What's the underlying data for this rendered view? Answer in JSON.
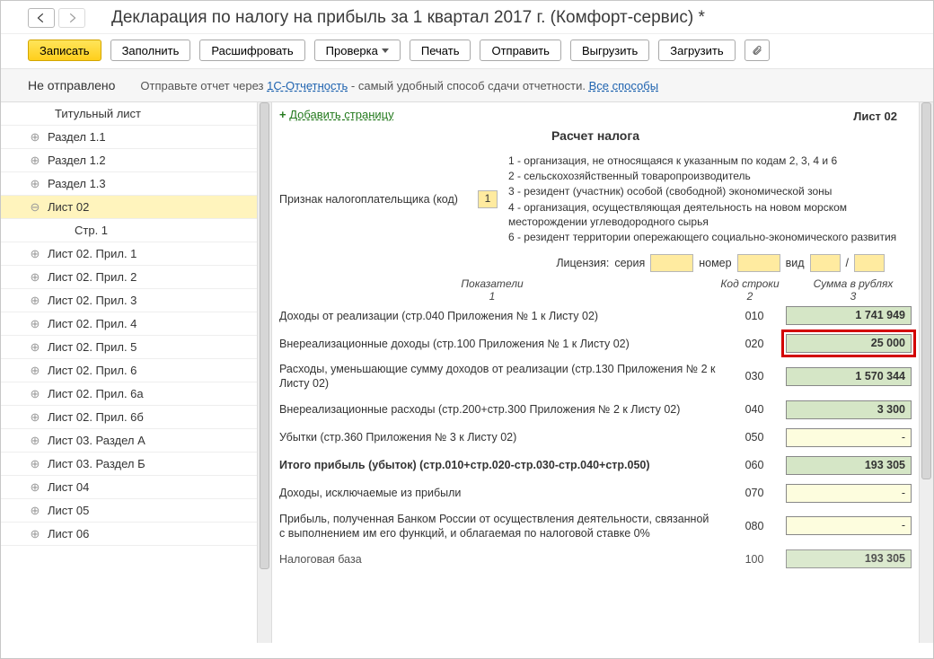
{
  "header": {
    "title": "Декларация по налогу на прибыль за 1 квартал 2017 г. (Комфорт-сервис) *"
  },
  "toolbar": {
    "save": "Записать",
    "fill": "Заполнить",
    "decode": "Расшифровать",
    "check": "Проверка",
    "print": "Печать",
    "send": "Отправить",
    "export": "Выгрузить",
    "import": "Загрузить"
  },
  "status": {
    "label": "Не отправлено",
    "hint_before": "Отправьте отчет через ",
    "hint_link1": "1С-Отчетность",
    "hint_after": " - самый удобный способ сдачи отчетности. ",
    "hint_link2": "Все способы"
  },
  "tree": [
    {
      "label": "Титульный лист",
      "level": "top",
      "exp": ""
    },
    {
      "label": "Раздел 1.1",
      "exp": "⊕"
    },
    {
      "label": "Раздел 1.2",
      "exp": "⊕"
    },
    {
      "label": "Раздел 1.3",
      "exp": "⊕"
    },
    {
      "label": "Лист 02",
      "exp": "⊖",
      "selected": true
    },
    {
      "label": "Стр. 1",
      "level": "child",
      "exp": ""
    },
    {
      "label": "Лист 02. Прил. 1",
      "exp": "⊕"
    },
    {
      "label": "Лист 02. Прил. 2",
      "exp": "⊕"
    },
    {
      "label": "Лист 02. Прил. 3",
      "exp": "⊕"
    },
    {
      "label": "Лист 02. Прил. 4",
      "exp": "⊕"
    },
    {
      "label": "Лист 02. Прил. 5",
      "exp": "⊕"
    },
    {
      "label": "Лист 02. Прил. 6",
      "exp": "⊕"
    },
    {
      "label": "Лист 02. Прил. 6а",
      "exp": "⊕"
    },
    {
      "label": "Лист 02. Прил. 6б",
      "exp": "⊕"
    },
    {
      "label": "Лист 03. Раздел А",
      "exp": "⊕"
    },
    {
      "label": "Лист 03. Раздел Б",
      "exp": "⊕"
    },
    {
      "label": "Лист 04",
      "exp": "⊕"
    },
    {
      "label": "Лист 05",
      "exp": "⊕"
    },
    {
      "label": "Лист 06",
      "exp": "⊕"
    }
  ],
  "sheet": {
    "add_page": "Добавить страницу",
    "sheet_label": "Лист 02",
    "section_title": "Расчет налога",
    "taxpayer_label": "Признак налогоплательщика (код)",
    "taxpayer_code": "1",
    "notes": [
      "1 - организация, не относящаяся к указанным по кодам 2, 3, 4 и 6",
      "2 - сельскохозяйственный товаропроизводитель",
      "3 - резидент (участник) особой (свободной) экономической зоны",
      "4 - организация, осуществляющая деятельность на новом морском месторождении углеводородного сырья",
      "6 - резидент территории опережающего социально-экономического развития"
    ],
    "license": {
      "label": "Лицензия:",
      "series": "серия",
      "number": "номер",
      "type": "вид",
      "slash": "/"
    },
    "col_headers": {
      "c1a": "Показатели",
      "c1b": "1",
      "c2a": "Код строки",
      "c2b": "2",
      "c3a": "Сумма в рублях",
      "c3b": "3"
    },
    "rows": [
      {
        "label": "Доходы от реализации (стр.040 Приложения № 1 к Листу 02)",
        "code": "010",
        "amount": "1 741 949",
        "cls": ""
      },
      {
        "label": "Внереализационные доходы (стр.100 Приложения № 1 к Листу 02)",
        "code": "020",
        "amount": "25 000",
        "cls": "highlight"
      },
      {
        "label": "Расходы, уменьшающие сумму доходов от реализации (стр.130 Приложения № 2 к Листу 02)",
        "code": "030",
        "amount": "1 570 344",
        "cls": ""
      },
      {
        "label": "Внереализационные расходы (стр.200+стр.300 Приложения № 2 к Листу 02)",
        "code": "040",
        "amount": "3 300",
        "cls": ""
      },
      {
        "label": "Убытки (стр.360 Приложения № 3 к Листу 02)",
        "code": "050",
        "amount": "-",
        "cls": "light dash"
      },
      {
        "label": "Итого прибыль (убыток)  (стр.010+стр.020-стр.030-стр.040+стр.050)",
        "code": "060",
        "amount": "193 305",
        "cls": "",
        "bold": true
      },
      {
        "label": "Доходы, исключаемые из прибыли",
        "code": "070",
        "amount": "-",
        "cls": "light dash"
      },
      {
        "label": "Прибыль, полученная Банком России от осуществления деятельности, связанной с выполнением им его функций, и облагаемая по налоговой ставке 0%",
        "code": "080",
        "amount": "-",
        "cls": "light dash"
      },
      {
        "label": "Налоговая база",
        "code": "100",
        "amount": "193 305",
        "cls": ""
      }
    ]
  }
}
